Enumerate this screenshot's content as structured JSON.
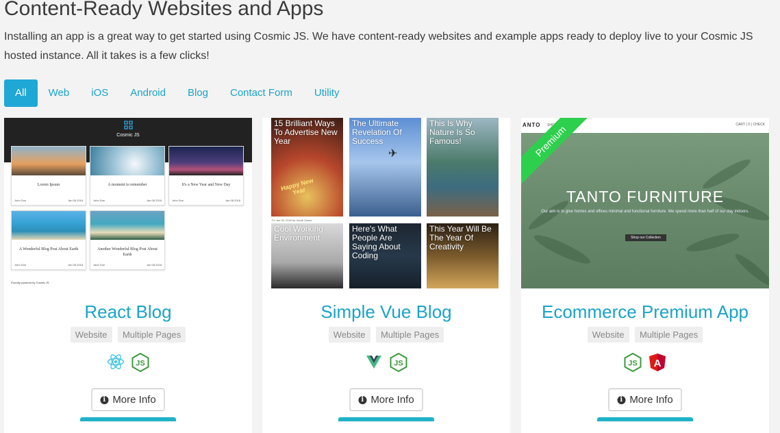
{
  "header": {
    "title": "Content-Ready Websites and Apps",
    "intro": "Installing an app is a great way to get started using Cosmic JS. We have content-ready websites and example apps ready to deploy live to your Cosmic JS hosted instance. All it takes is a few clicks!"
  },
  "tabs": [
    {
      "label": "All",
      "active": true
    },
    {
      "label": "Web"
    },
    {
      "label": "iOS"
    },
    {
      "label": "Android"
    },
    {
      "label": "Blog"
    },
    {
      "label": "Contact Form"
    },
    {
      "label": "Utility"
    }
  ],
  "cards": [
    {
      "title": "React Blog",
      "tags": [
        "Website",
        "Multiple Pages"
      ],
      "icons": [
        "react-icon",
        "nodejs-icon"
      ],
      "button": "More Info",
      "thumb": {
        "brand": "Cosmic JS",
        "posts": [
          {
            "title": "Lorem Ipsum",
            "author": "John Doe",
            "date": "Jan 08 2018"
          },
          {
            "title": "A moment to remember",
            "author": "John Doe",
            "date": "Jan 08 2018"
          },
          {
            "title": "It's a New Year and New Day",
            "author": "John Doe",
            "date": "Jan 08 2018"
          },
          {
            "title": "A Wonderful Blog Post About Earth",
            "author": "John Doe",
            "date": "Jan 08 2018"
          },
          {
            "title": "Another Wonderful Blog Post About Earth",
            "author": "Jane Doe",
            "date": "Jan 08 2018"
          }
        ],
        "footer": "Proudly powered by Cosmic JS"
      }
    },
    {
      "title": "Simple Vue Blog",
      "tags": [
        "Website",
        "Multiple Pages"
      ],
      "icons": [
        "vue-icon",
        "nodejs-icon"
      ],
      "button": "More Info",
      "thumb": {
        "tiles": [
          "15 Brilliant Ways To Advertise New Year",
          "The Ultimate Revelation Of Success",
          "This Is Why Nature Is So Famous!",
          "Cool Working Environment",
          "Here's What People Are Saying About Coding",
          "This Year Will Be The Year Of Creativity"
        ],
        "tile_overlay": "Happy New Year",
        "date": "Fri Jan 05, 2018 by Jacob Zamer"
      }
    },
    {
      "title": "Ecommerce Premium App",
      "tags": [
        "Website",
        "Multiple Pages"
      ],
      "icons": [
        "nodejs-icon",
        "angular-icon"
      ],
      "button": "More Info",
      "thumb": {
        "brand": "ANTO",
        "nav": "SHOP",
        "cart": "CART ( 0 )    CHECK",
        "ribbon": "Premium",
        "hero_title": "TANTO FURNITURE",
        "hero_sub": "Our aim is to give homes and offices minimal and functional furniture. We spend more than half of our day indoors.",
        "cta": "Shop our Collection"
      }
    }
  ],
  "colors": {
    "accent": "#1fa7d6",
    "link": "#1aa3c8",
    "premium": "#2dd04c"
  }
}
